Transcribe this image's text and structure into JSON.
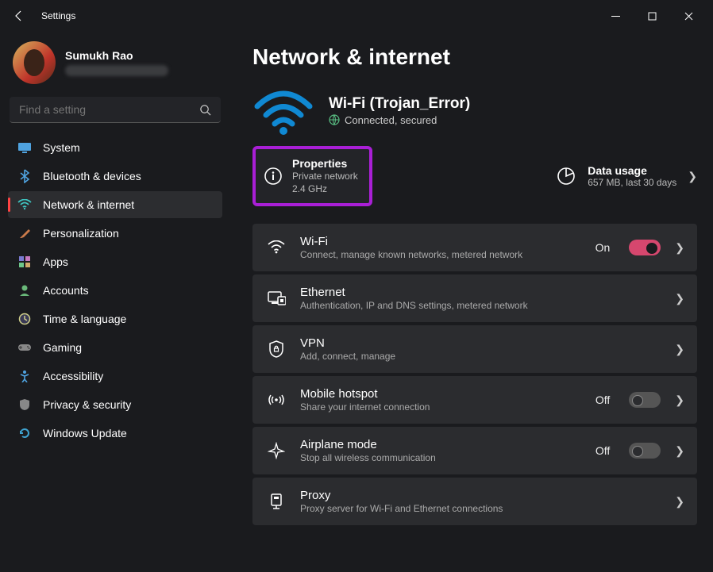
{
  "app": {
    "title": "Settings"
  },
  "user": {
    "name": "Sumukh Rao"
  },
  "search": {
    "placeholder": "Find a setting"
  },
  "sidebar": {
    "items": [
      {
        "label": "System"
      },
      {
        "label": "Bluetooth & devices"
      },
      {
        "label": "Network & internet"
      },
      {
        "label": "Personalization"
      },
      {
        "label": "Apps"
      },
      {
        "label": "Accounts"
      },
      {
        "label": "Time & language"
      },
      {
        "label": "Gaming"
      },
      {
        "label": "Accessibility"
      },
      {
        "label": "Privacy & security"
      },
      {
        "label": "Windows Update"
      }
    ]
  },
  "page": {
    "title": "Network & internet",
    "wifi": {
      "name": "Wi-Fi (Trojan_Error)",
      "status": "Connected, secured"
    },
    "properties": {
      "title": "Properties",
      "line1": "Private network",
      "line2": "2.4 GHz"
    },
    "dataUsage": {
      "title": "Data usage",
      "sub": "657 MB, last 30 days"
    },
    "settings": [
      {
        "title": "Wi-Fi",
        "sub": "Connect, manage known networks, metered network",
        "toggle": "On"
      },
      {
        "title": "Ethernet",
        "sub": "Authentication, IP and DNS settings, metered network"
      },
      {
        "title": "VPN",
        "sub": "Add, connect, manage"
      },
      {
        "title": "Mobile hotspot",
        "sub": "Share your internet connection",
        "toggle": "Off"
      },
      {
        "title": "Airplane mode",
        "sub": "Stop all wireless communication",
        "toggle": "Off"
      },
      {
        "title": "Proxy",
        "sub": "Proxy server for Wi-Fi and Ethernet connections"
      }
    ]
  }
}
